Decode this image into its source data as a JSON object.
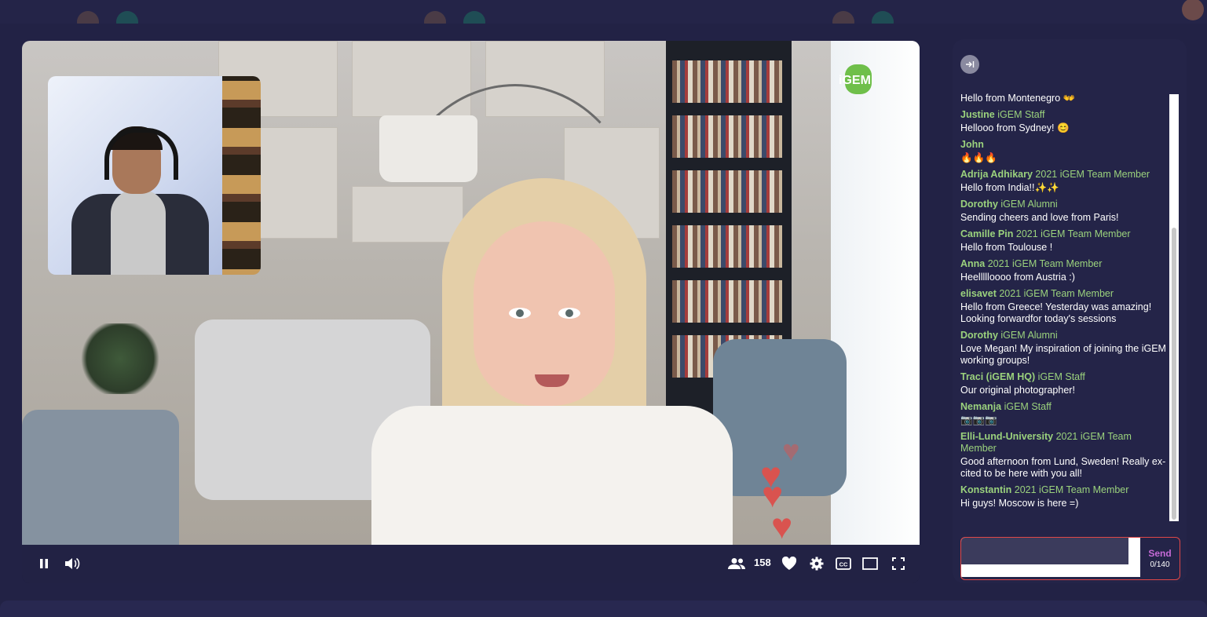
{
  "stream": {
    "viewer_count": "158",
    "logo_text": "iGEM"
  },
  "controls": {
    "icons": [
      "pause-icon",
      "volume-icon",
      "viewers-icon",
      "heart-icon",
      "gear-icon",
      "captions-icon",
      "theater-mode-icon",
      "fullscreen-icon"
    ]
  },
  "chat": {
    "collapse_icon": "collapse-arrow-icon",
    "messages": [
      {
        "user": "",
        "role": "",
        "text": "Hello from Montenegro 👐"
      },
      {
        "user": "Justine",
        "role": "iGEM Staff",
        "text": "Hellooo from Sydney! 😊"
      },
      {
        "user": "John",
        "role": "",
        "text": "🔥🔥🔥"
      },
      {
        "user": "Adrija Adhikary",
        "role": "2021 iGEM Team Member",
        "text": "Hello from India!!✨✨"
      },
      {
        "user": "Dorothy",
        "role": "iGEM Alumni",
        "text": "Sending cheers and love from Paris!"
      },
      {
        "user": "Camille Pin",
        "role": "2021 iGEM Team Member",
        "text": "Hello from Toulouse !"
      },
      {
        "user": "Anna",
        "role": "2021 iGEM Team Member",
        "text": "Heellllloooo from Austria :)"
      },
      {
        "user": "elisavet",
        "role": "2021 iGEM Team Member",
        "text": "Hello from Greece! Yesterday was amazing! Looking forwardfor today's sessions"
      },
      {
        "user": "Dorothy",
        "role": "iGEM Alumni",
        "text": "Love Megan! My inspiration of joining the iGEM working groups!"
      },
      {
        "user": "Traci (iGEM HQ)",
        "role": "iGEM Staff",
        "text": "Our original photographer!"
      },
      {
        "user": "Nemanja",
        "role": "iGEM Staff",
        "text": "📷📷📷"
      },
      {
        "user": "Elli-Lund-University",
        "role": "2021 iGEM Team Member",
        "text": "Good afternoon from Lund, Sweden! Really ex-cited to be here with you all!"
      },
      {
        "user": "Konstantin",
        "role": "2021 iGEM Team Member",
        "text": "Hi guys! Moscow is here =)"
      }
    ],
    "input_value": "",
    "send_label": "Send",
    "char_count": "0/140"
  },
  "colors": {
    "background": "#222245",
    "username": "#9bd27d",
    "send": "#c56ad6",
    "input_border": "#e04848",
    "heart": "#d9534f"
  }
}
